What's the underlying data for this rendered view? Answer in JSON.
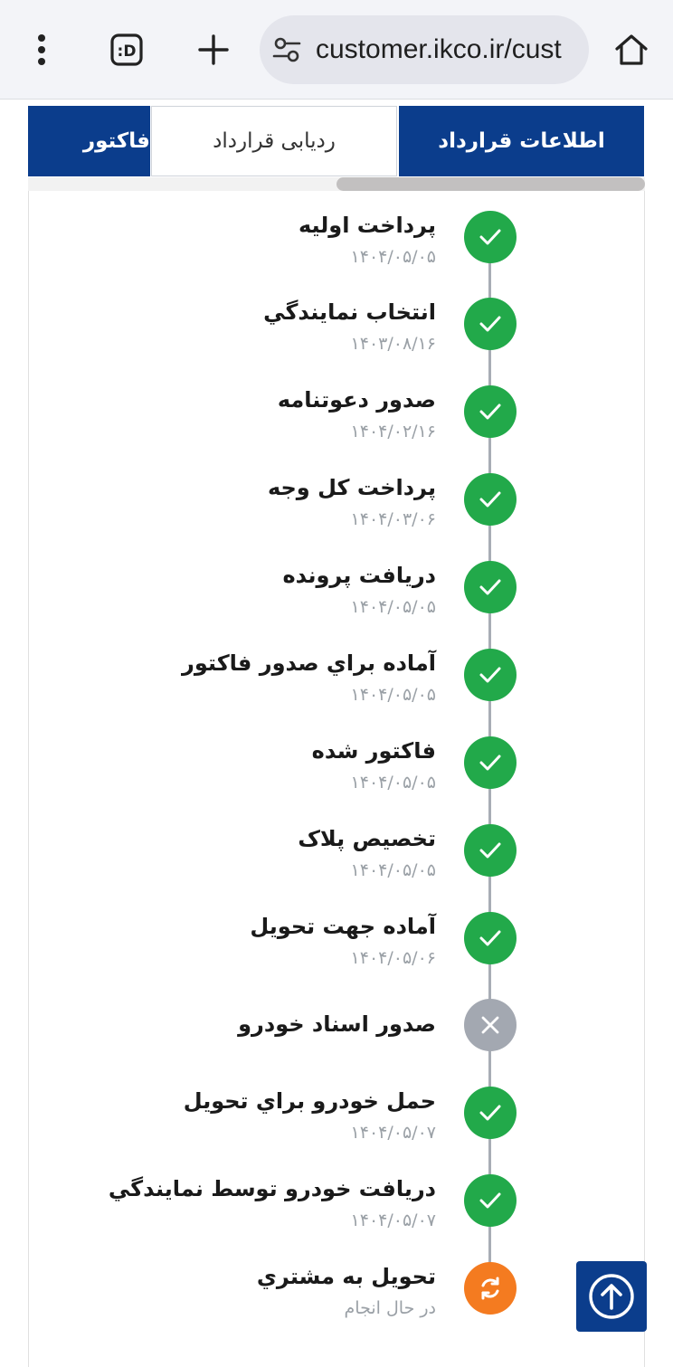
{
  "browser": {
    "url": "customer.ikco.ir/cust",
    "icons": [
      "home-icon",
      "site-settings-icon",
      "new-tab-plus-icon",
      "tab-switcher-icon",
      "more-menu-icon"
    ]
  },
  "tabs": [
    {
      "label": "اطلاعات قرارداد",
      "state": "active"
    },
    {
      "label": "ردیابی قرارداد",
      "state": "selected"
    },
    {
      "label": "فاکتور",
      "state": "active"
    }
  ],
  "steps": [
    {
      "title": "پرداخت اولیه",
      "date": "۱۴۰۴/۰۵/۰۵",
      "status": "done"
    },
    {
      "title": "انتخاب نمایندگي",
      "date": "۱۴۰۳/۰۸/۱۶",
      "status": "done"
    },
    {
      "title": "صدور دعوتنامه",
      "date": "۱۴۰۴/۰۲/۱۶",
      "status": "done"
    },
    {
      "title": "پرداخت کل وجه",
      "date": "۱۴۰۴/۰۳/۰۶",
      "status": "done"
    },
    {
      "title": "دریافت پرونده",
      "date": "۱۴۰۴/۰۵/۰۵",
      "status": "done"
    },
    {
      "title": "آماده براي صدور فاکتور",
      "date": "۱۴۰۴/۰۵/۰۵",
      "status": "done"
    },
    {
      "title": "فاکتور شده",
      "date": "۱۴۰۴/۰۵/۰۵",
      "status": "done"
    },
    {
      "title": "تخصیص پلاک",
      "date": "۱۴۰۴/۰۵/۰۵",
      "status": "done"
    },
    {
      "title": "آماده جهت تحویل",
      "date": "۱۴۰۴/۰۵/۰۶",
      "status": "done"
    },
    {
      "title": "صدور اسناد خودرو",
      "date": "",
      "status": "cancel"
    },
    {
      "title": "حمل خودرو براي تحویل",
      "date": "۱۴۰۴/۰۵/۰۷",
      "status": "done"
    },
    {
      "title": "دریافت خودرو توسط نمایندگي",
      "date": "۱۴۰۴/۰۵/۰۷",
      "status": "done"
    },
    {
      "title": "تحویل به مشتري",
      "date": "در حال انجام",
      "status": "progress"
    }
  ],
  "colors": {
    "primary": "#0b3d8c",
    "done": "#22a94a",
    "cancel": "#a3a8b1",
    "progress": "#f47b20"
  }
}
